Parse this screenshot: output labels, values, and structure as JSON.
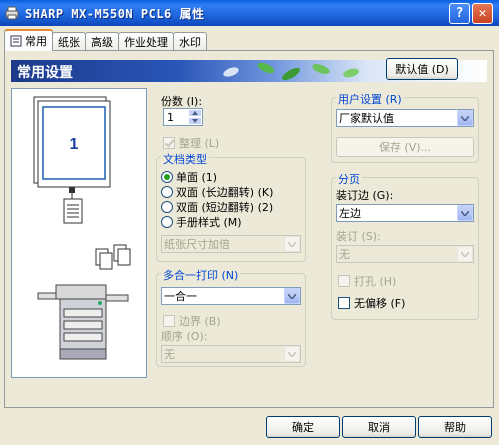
{
  "window": {
    "title": "SHARP MX-M550N PCL6 属性"
  },
  "tabs": [
    {
      "label": "常用",
      "active": true
    },
    {
      "label": "纸张",
      "active": false
    },
    {
      "label": "高级",
      "active": false
    },
    {
      "label": "作业处理",
      "active": false
    },
    {
      "label": "水印",
      "active": false
    }
  ],
  "header": {
    "title": "常用设置",
    "default_button": "默认值 (D)"
  },
  "preview": {
    "page_number": "1"
  },
  "copies": {
    "label": "份数 (I):",
    "value": "1"
  },
  "collate": {
    "label": "整理 (L)",
    "checked": true,
    "enabled": false
  },
  "document_style": {
    "title": "文档类型",
    "options": [
      {
        "label": "单面 (1)",
        "selected": true
      },
      {
        "label": "双面 (长边翻转) (K)",
        "selected": false
      },
      {
        "label": "双面 (短边翻转) (2)",
        "selected": false
      },
      {
        "label": "手册样式 (M)",
        "selected": false
      }
    ],
    "booklet_select": "纸张尺寸加倍"
  },
  "nup": {
    "title": "多合一打印 (N)",
    "selected": "一合一",
    "border_label": "边界 (B)",
    "order_label": "顺序 (O):",
    "order_value": "无"
  },
  "user_settings": {
    "title": "用户设置 (R)",
    "selected": "厂家默认值",
    "save_button": "保存 (V)..."
  },
  "finishing": {
    "title": "分页",
    "binding_edge_label": "装订边 (G):",
    "binding_edge_value": "左边",
    "staple_label": "装订 (S):",
    "staple_value": "无",
    "punch_label": "打孔 (H)",
    "no_offset_label": "无偏移 (F)"
  },
  "buttons": {
    "ok": "确定",
    "cancel": "取消",
    "help": "帮助"
  },
  "colors": {
    "title_bar": "#0a5fe0",
    "accent_tab": "#e68b2c",
    "group_title": "#0046d5"
  }
}
